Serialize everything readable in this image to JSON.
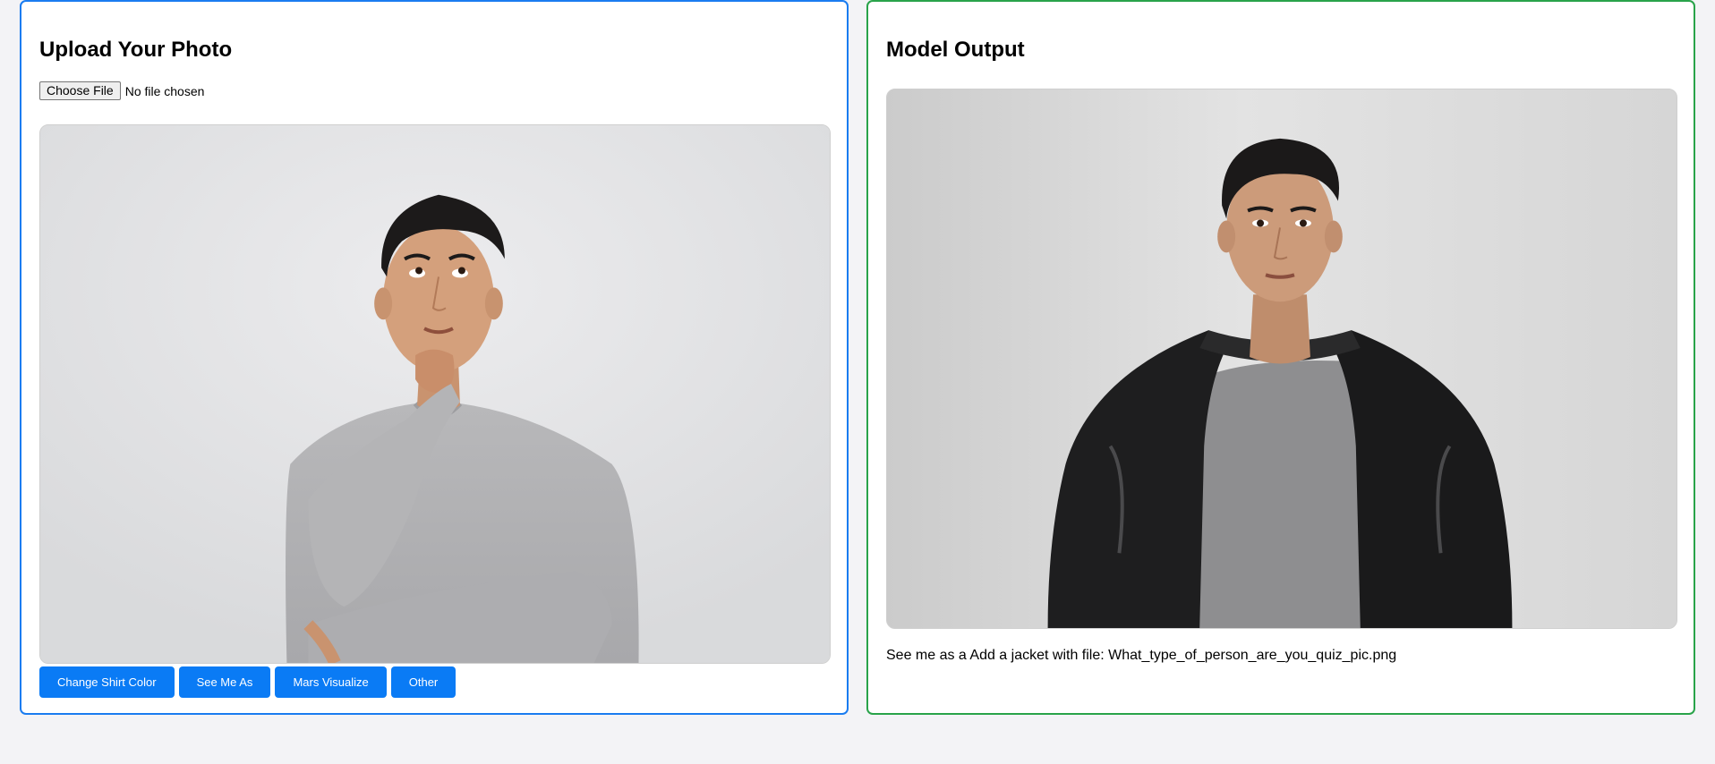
{
  "upload_panel": {
    "title": "Upload Your Photo",
    "file_button_label": "Choose File",
    "file_status": "No file chosen",
    "photo_icon": "person-thinking-photo",
    "buttons": [
      {
        "label": "Change Shirt Color"
      },
      {
        "label": "See Me As"
      },
      {
        "label": "Mars Visualize"
      },
      {
        "label": "Other"
      }
    ],
    "border_color": "#1a7cf0"
  },
  "output_panel": {
    "title": "Model Output",
    "photo_icon": "person-leather-jacket-photo",
    "caption": "See me as a Add a jacket with file: What_type_of_person_are_you_quiz_pic.png",
    "border_color": "#29a34a"
  },
  "colors": {
    "button_bg": "#0a7bf5",
    "page_bg": "#f3f3f6"
  }
}
